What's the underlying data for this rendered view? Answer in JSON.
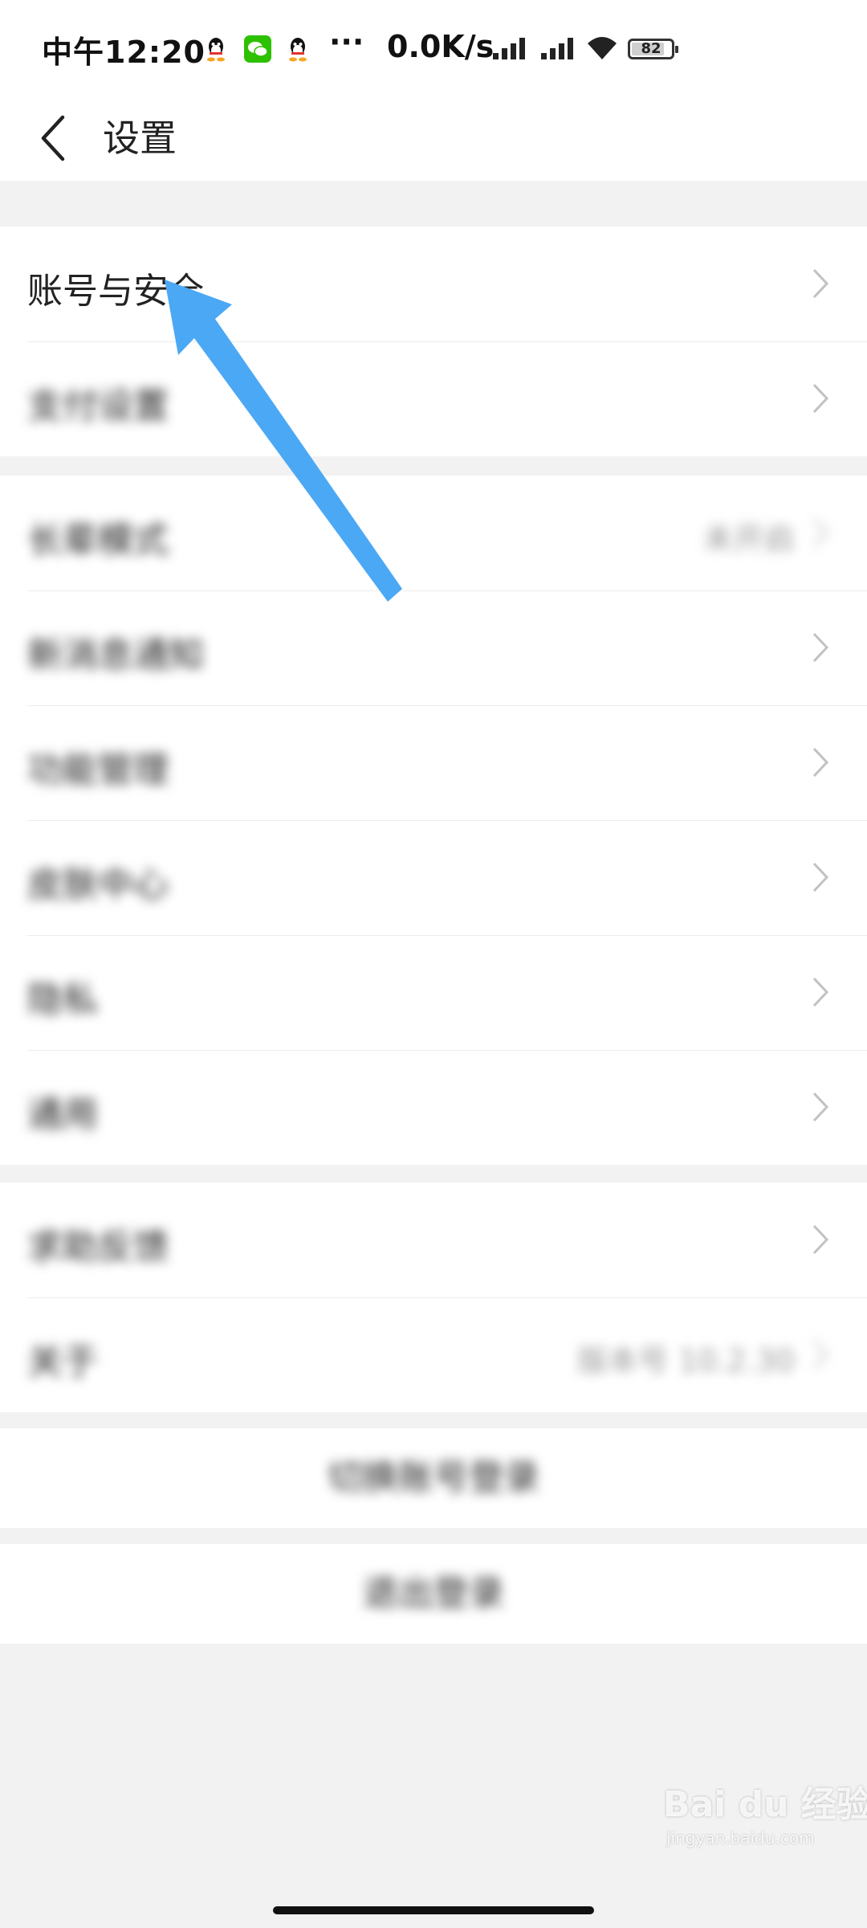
{
  "status_bar": {
    "time": "中午12:20",
    "dots": "···",
    "net_speed": "0.0K/s",
    "battery": "82",
    "icons": [
      "qq-icon",
      "wechat-icon",
      "qq-icon"
    ]
  },
  "header": {
    "title": "设置"
  },
  "groups": [
    {
      "items": [
        {
          "label": "账号与安全",
          "value": ""
        },
        {
          "label": "支付设置",
          "value": ""
        }
      ]
    },
    {
      "items": [
        {
          "label": "长辈模式",
          "value": "未开启"
        },
        {
          "label": "新消息通知",
          "value": ""
        },
        {
          "label": "功能管理",
          "value": ""
        },
        {
          "label": "皮肤中心",
          "value": ""
        },
        {
          "label": "隐私",
          "value": ""
        },
        {
          "label": "通用",
          "value": ""
        }
      ]
    },
    {
      "items": [
        {
          "label": "求助反馈",
          "value": ""
        },
        {
          "label": "关于",
          "value": "版本号 10.2.30"
        }
      ]
    }
  ],
  "actions": {
    "switch_account": "切换账号登录",
    "logout": "退出登录"
  },
  "watermark": {
    "main": "Bai du 经验",
    "sub": "jingyan.baidu.com"
  },
  "colors": {
    "arrow": "#4ba8f5",
    "background": "#f2f2f2",
    "card": "#ffffff",
    "chevron": "#c2c2c2"
  }
}
